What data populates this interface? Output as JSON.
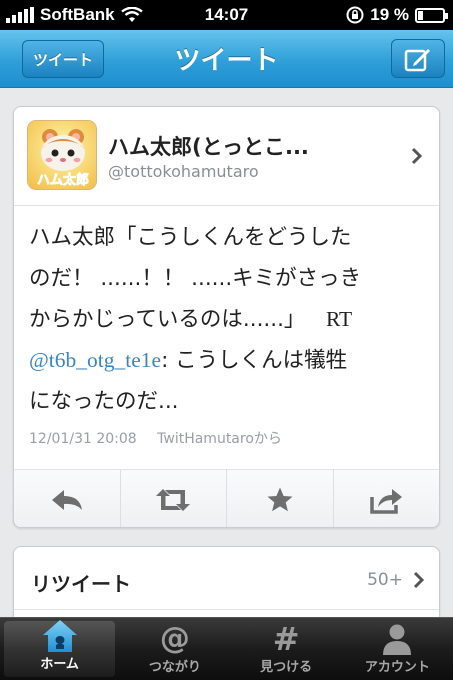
{
  "status_bar": {
    "carrier": "SoftBank",
    "time": "14:07",
    "battery_percent": "19 %",
    "battery_level": 0.19
  },
  "nav": {
    "back_label": "ツイート",
    "title": "ツイート",
    "compose_icon": "compose-icon"
  },
  "tweet": {
    "display_name": "ハム太郎(とっとこ...",
    "handle": "@tottokohamutaro",
    "text_line1": "ハム太郎「こうしくんをどうした",
    "text_line2": "のだ！ ......！！ ......キミがさっき",
    "text_line3_a": "からかじっているのは......」",
    "text_line3_rt": "RT",
    "mention": "@t6b_otg_te1e",
    "text_line4_rest": ": こうしくんは犠牲",
    "text_line5": "になったのだ...",
    "timestamp": "12/01/31 20:08",
    "via": "TwitHamutaroから"
  },
  "actions": [
    {
      "icon": "reply-icon"
    },
    {
      "icon": "retweet-icon"
    },
    {
      "icon": "favorite-star-icon"
    },
    {
      "icon": "share-icon"
    }
  ],
  "retweets": {
    "label": "リツイート",
    "count": "50+"
  },
  "tabs": [
    {
      "label": "ホーム",
      "icon": "home-icon",
      "active": true
    },
    {
      "label": "つながり",
      "icon": "at-icon",
      "glyph": "@"
    },
    {
      "label": "見つける",
      "icon": "hash-icon",
      "glyph": "#"
    },
    {
      "label": "アカウント",
      "icon": "account-icon"
    }
  ],
  "colors": {
    "nav_blue": "#2f9fd9",
    "mention_blue": "#3a86bd",
    "tab_active_blue": "#2f9fd9"
  }
}
